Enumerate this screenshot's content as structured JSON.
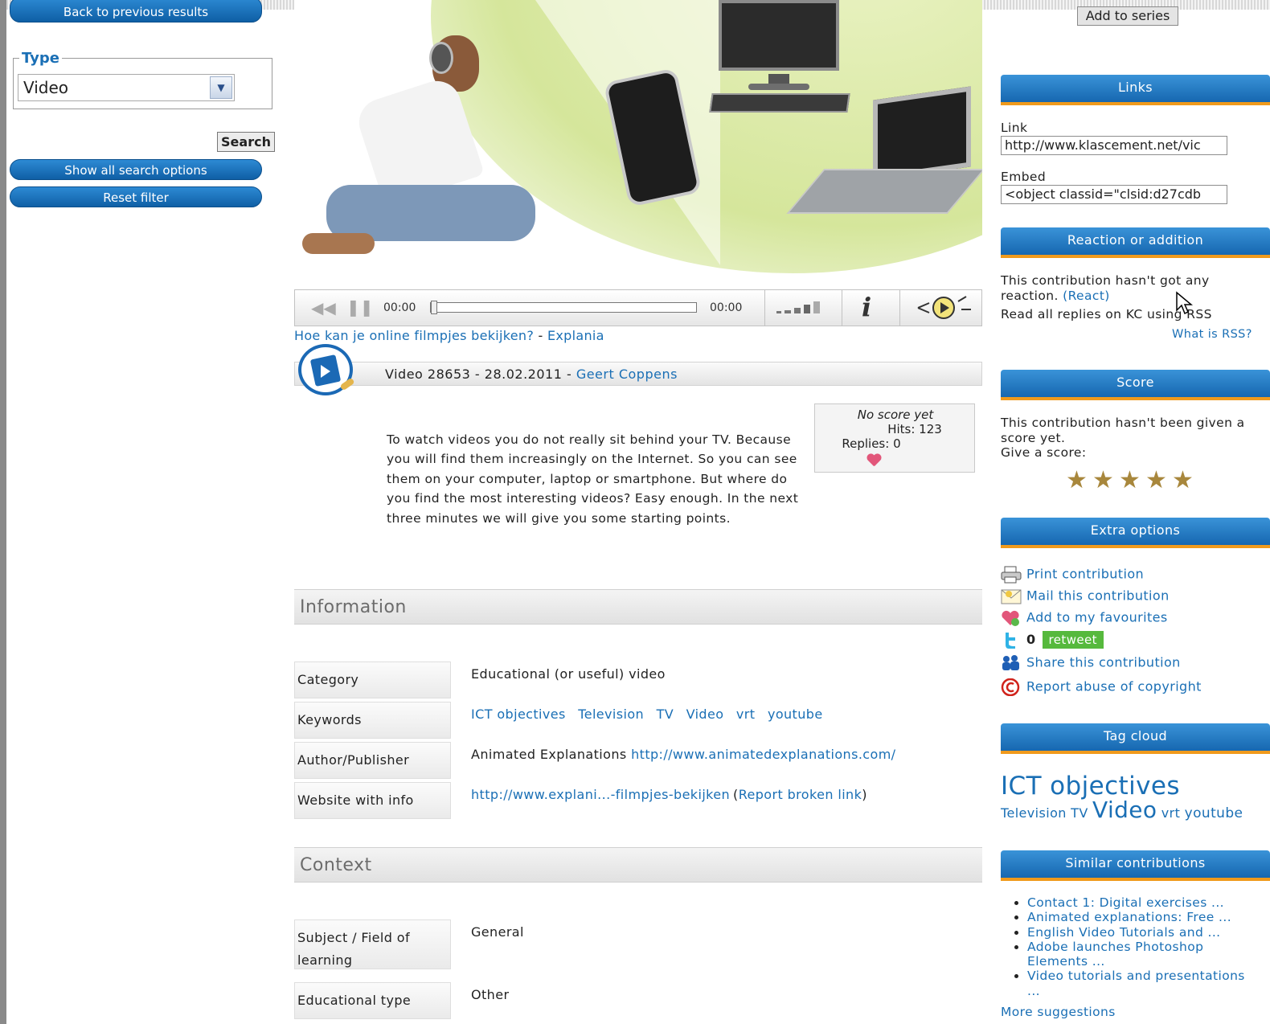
{
  "left": {
    "back_label": "Back to previous results",
    "type_legend": "Type",
    "type_value": "Video",
    "search_label": "Search",
    "show_all_label": "Show all search options",
    "reset_label": "Reset filter"
  },
  "player": {
    "time_elapsed": "00:00",
    "time_total": "00:00"
  },
  "video": {
    "title_link": "Hoe kan je online filmpjes bekijken?",
    "title_sep": " - ",
    "title_source": "Explania",
    "meta_text": "Video 28653 - 28.02.2011 - ",
    "meta_author": "Geert Coppens",
    "description": "To watch videos you do not really sit behind your TV. Because you will find them increasingly on the Internet. So you can see them on your computer, laptop or smartphone. But where do you find the most interesting videos? Easy enough. In the next three minutes we will give you some starting points."
  },
  "scorebox": {
    "no_score": "No score yet",
    "hits": "Hits: 123",
    "replies": "Replies: 0"
  },
  "information": {
    "heading": "Information",
    "category_label": "Category",
    "category_value": "Educational (or useful) video",
    "keywords_label": "Keywords",
    "keywords": [
      "ICT objectives",
      "Television",
      "TV",
      "Video",
      "vrt",
      "youtube"
    ],
    "author_label": "Author/Publisher",
    "author_name": "Animated Explanations",
    "author_url": "http://www.animatedexplanations.com/",
    "website_label": "Website with info",
    "website_url": "http://www.explani...-filmpjes-bekijken",
    "report_open": "(",
    "report_link": "Report broken link",
    "report_close": ")"
  },
  "context": {
    "heading": "Context",
    "subject_label": "Subject / Field of learning",
    "subject_value": "General",
    "edutype_label": "Educational type",
    "edutype_value": "Other"
  },
  "right": {
    "add_series": "Add to series",
    "links_heading": "Links",
    "link_label": "Link",
    "link_value": "http://www.klascement.net/vic",
    "embed_label": "Embed",
    "embed_value": "<object classid=\"clsid:d27cdb",
    "reaction_heading": "Reaction or addition",
    "reaction_text": "This contribution hasn't got any reaction.",
    "react_link": "(React)",
    "rss_text": "Read all replies on KC using RSS",
    "what_rss": "What is RSS?",
    "score_heading": "Score",
    "score_text": "This contribution hasn't been given a score yet.",
    "give_score": "Give a score:",
    "extra_heading": "Extra options",
    "print": "Print contribution",
    "mail": "Mail this contribution",
    "favourites": "Add to my favourites",
    "tweet_count": "0",
    "retweet": "retweet",
    "share": "Share this contribution",
    "report_abuse": "Report abuse of copyright",
    "tag_heading": "Tag cloud",
    "tag_big": "ICT objectives",
    "tag_television": "Television",
    "tag_tv": "TV",
    "tag_video": "Video",
    "tag_vrt": "vrt",
    "tag_youtube": "youtube",
    "similar_heading": "Similar contributions",
    "similar": [
      "Contact 1: Digital exercises ...",
      "Animated explanations: Free ...",
      "English Video Tutorials and ...",
      "Adobe launches Photoshop Elements ...",
      "Video tutorials and presentations ..."
    ],
    "more": "More suggestions"
  },
  "colors": {
    "accent": "#1a6fb5",
    "header_blue": "#1667b0",
    "header_underline": "#f09a1c"
  },
  "icons": [
    "rewind-icon",
    "pause-icon",
    "volume-icon",
    "info-icon",
    "popout-icon",
    "video-icon",
    "printer-icon",
    "mail-icon",
    "heart-icon",
    "twitter-icon",
    "share-icon",
    "copyright-icon",
    "star-icon"
  ]
}
